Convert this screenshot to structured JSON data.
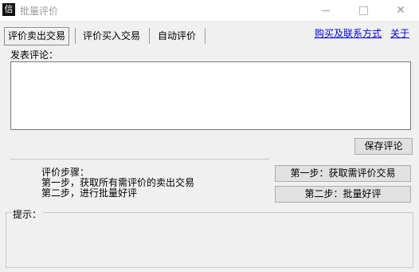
{
  "window": {
    "title": "批量评价",
    "icon_char": "信",
    "controls": [
      "minimize",
      "maximize",
      "close"
    ]
  },
  "tabs": [
    {
      "label": "评价卖出交易",
      "active": true
    },
    {
      "label": "评价买入交易",
      "active": false
    },
    {
      "label": "自动评价",
      "active": false
    }
  ],
  "links": {
    "purchase": "购买及联系方式",
    "about": "关于"
  },
  "comment": {
    "label": "发表评论：",
    "value": ""
  },
  "buttons": {
    "save": "保存评论",
    "step1": "第一步：获取需评价交易",
    "step2": "第二步：批量好评"
  },
  "steps": {
    "heading": "评价步骤：",
    "line1": "第一步，获取所有需评价的卖出交易",
    "line2": "第二步，进行批量好评"
  },
  "hint": {
    "label": "提示："
  }
}
